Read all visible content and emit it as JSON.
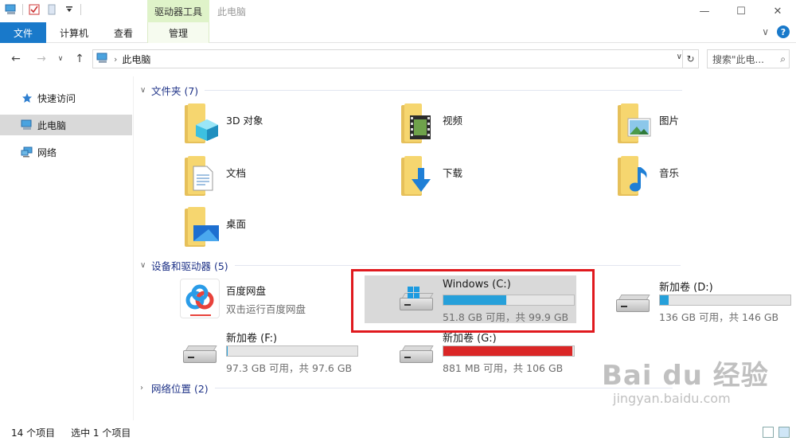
{
  "titlebar": {
    "context_tab_header": "驱动器工具",
    "title": "此电脑",
    "minimize": "—",
    "maximize": "☐",
    "close": "✕"
  },
  "ribbon": {
    "tabs": [
      "文件",
      "计算机",
      "查看",
      "管理"
    ],
    "expand": "∨",
    "help": "?"
  },
  "address": {
    "crumb": "此电脑",
    "dropdown": "∨",
    "refresh": "↻",
    "search_placeholder": "搜索\"此电...",
    "search_icon": "⌕"
  },
  "nav": {
    "back": "←",
    "forward": "→",
    "recent": "∨",
    "up": "↑",
    "items": [
      {
        "label": "快速访问",
        "icon": "star-icon"
      },
      {
        "label": "此电脑",
        "icon": "computer-icon"
      },
      {
        "label": "网络",
        "icon": "network-icon"
      }
    ]
  },
  "groups": {
    "folders": {
      "title": "文件夹 (7)",
      "chev": "∨"
    },
    "devices": {
      "title": "设备和驱动器 (5)",
      "chev": "∨"
    },
    "network": {
      "title": "网络位置 (2)",
      "chev": "›"
    }
  },
  "folders": [
    {
      "label": "3D 对象",
      "icon": "3d-objects-icon"
    },
    {
      "label": "视频",
      "icon": "video-icon"
    },
    {
      "label": "图片",
      "icon": "pictures-icon"
    },
    {
      "label": "文档",
      "icon": "documents-icon"
    },
    {
      "label": "下载",
      "icon": "download-icon"
    },
    {
      "label": "音乐",
      "icon": "music-icon"
    },
    {
      "label": "桌面",
      "icon": "desktop-icon"
    }
  ],
  "baidu": {
    "name": "百度网盘",
    "desc": "双击运行百度网盘"
  },
  "drives": [
    {
      "name": "Windows (C:)",
      "space": "51.8 GB 可用，共 99.9 GB",
      "used_fraction": 0.48,
      "selected": true
    },
    {
      "name": "新加卷 (D:)",
      "space": "136 GB 可用，共 146 GB",
      "used_fraction": 0.07,
      "selected": false
    },
    {
      "name": "新加卷 (F:)",
      "space": "97.3 GB 可用，共 97.6 GB",
      "used_fraction": 0.003,
      "selected": false
    },
    {
      "name": "新加卷 (G:)",
      "space": "881 MB 可用，共 106 GB",
      "used_fraction": 0.99,
      "selected": false,
      "critical": true
    }
  ],
  "status": {
    "count": "14 个项目",
    "selected": "选中 1 个项目"
  },
  "colors": {
    "accent": "#1979ca",
    "bar_fill": "#26a0da",
    "bar_critical": "#da2626",
    "highlight": "#e0191e",
    "selection": "#d9d9d9"
  },
  "watermark": {
    "line1": "Bai du 经验",
    "line2": "jingyan.baidu.com"
  }
}
